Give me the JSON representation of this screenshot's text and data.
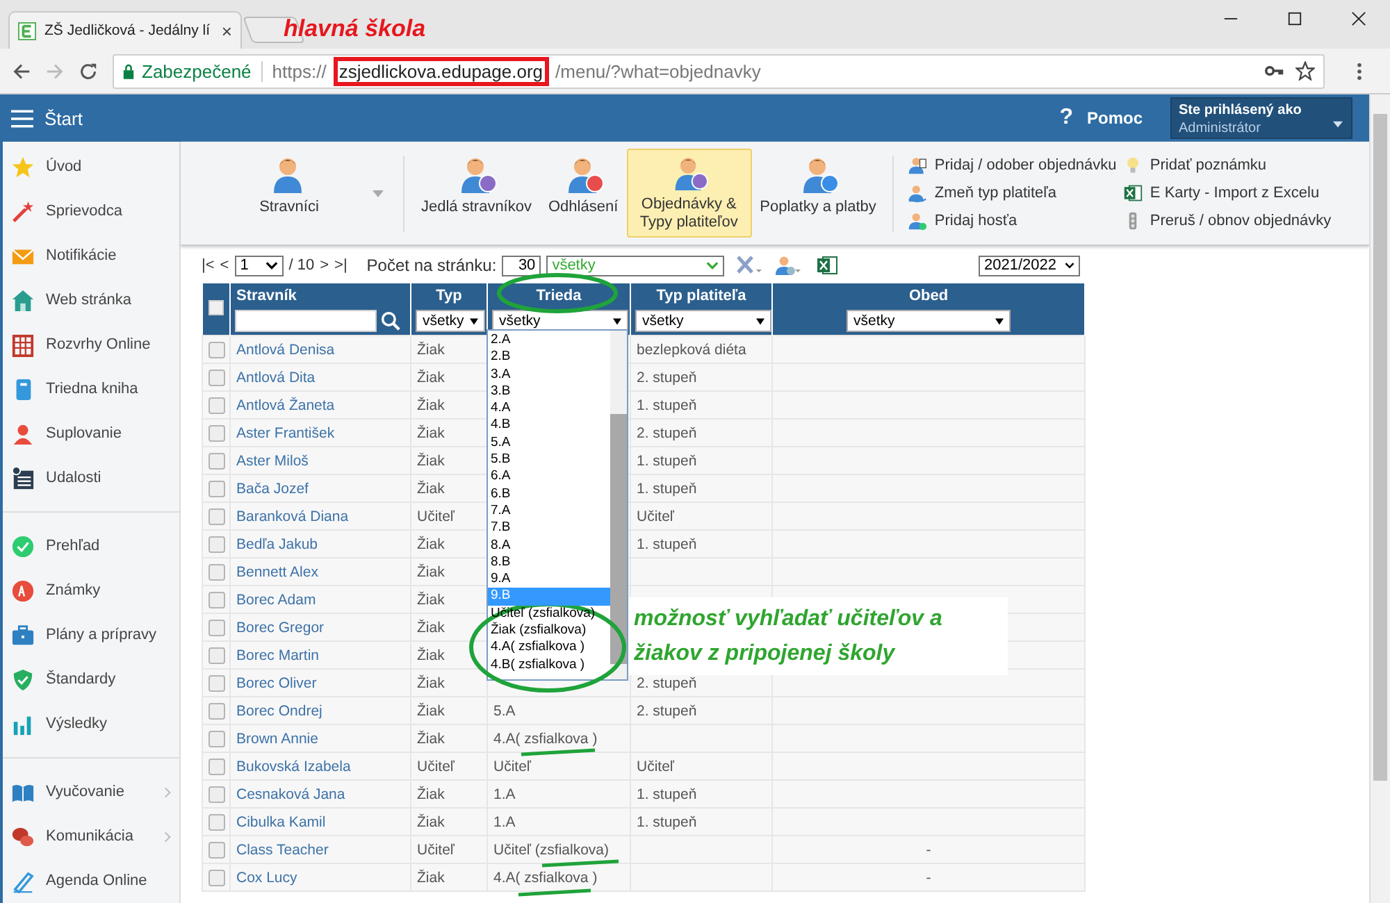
{
  "browser": {
    "tab_title": "ZŠ Jedličková - Jedálny lí",
    "tab_close": "×",
    "security_label": "Zabezpečené",
    "url_scheme": "https://",
    "url_host": "zsjedlickova.edupage.org",
    "url_path": "/menu/?what=objednavky"
  },
  "annotations": {
    "school_label": "hlavná škola",
    "note_lines": [
      "možnosť vyhľadať učiteľov a",
      "žiakov z pripojenej školy"
    ]
  },
  "header": {
    "title": "Štart",
    "help_icon": "?",
    "help": "Pomoc",
    "user_caption": "Ste prihlásený ako",
    "user_role": "Administrátor"
  },
  "toolbar": {
    "main": "Stravníci",
    "items": [
      {
        "label": "Jedlá stravníkov",
        "selected": false
      },
      {
        "label": "Odhlásení",
        "selected": false
      },
      {
        "label": "Objednávky & Typy platiteľov",
        "selected": true
      },
      {
        "label": "Poplatky a platby",
        "selected": false
      }
    ],
    "actions": [
      "Pridaj / odober objednávku",
      "Zmeň typ platiteľa",
      "Pridaj hosťa",
      "Pridať poznámku",
      "E Karty - Import z Excelu",
      "Preruš / obnov objednávky"
    ]
  },
  "sidebar": {
    "groups": [
      {
        "items": [
          {
            "label": "Úvod",
            "has_submenu": false
          },
          {
            "label": "Sprievodca",
            "has_submenu": false
          },
          {
            "label": "Notifikácie",
            "has_submenu": false
          },
          {
            "label": "Web stránka",
            "has_submenu": false
          },
          {
            "label": "Rozvrhy Online",
            "has_submenu": false
          },
          {
            "label": "Triedna kniha",
            "has_submenu": false
          },
          {
            "label": "Suplovanie",
            "has_submenu": false
          },
          {
            "label": "Udalosti",
            "has_submenu": false
          }
        ]
      },
      {
        "items": [
          {
            "label": "Prehľad",
            "has_submenu": false
          },
          {
            "label": "Známky",
            "has_submenu": false
          },
          {
            "label": "Plány a prípravy",
            "has_submenu": false
          },
          {
            "label": "Štandardy",
            "has_submenu": false
          },
          {
            "label": "Výsledky",
            "has_submenu": false
          }
        ]
      },
      {
        "items": [
          {
            "label": "Vyučovanie",
            "has_submenu": true
          },
          {
            "label": "Komunikácia",
            "has_submenu": true
          },
          {
            "label": "Agenda Online",
            "has_submenu": false
          }
        ]
      }
    ]
  },
  "pager": {
    "first": "|<",
    "prev": "<",
    "page": "1",
    "total": "/ 10",
    "next": ">",
    "last": ">|",
    "per_page_label": "Počet na stránku:",
    "per_page": "30",
    "filter": "všetky",
    "year": "2021/2022"
  },
  "table": {
    "all_checked": false,
    "columns": [
      "Stravník",
      "Typ",
      "Trieda",
      "Typ platiteľa",
      "Obed"
    ],
    "filters": [
      "všetky",
      "všetky",
      "všetky",
      "všetky"
    ],
    "rows": [
      {
        "name": "Antlová Denisa",
        "type": "Žiak",
        "payer": "bezlepková diéta",
        "checked": false
      },
      {
        "name": "Antlová Dita",
        "type": "Žiak",
        "payer": "2. stupeň",
        "checked": false
      },
      {
        "name": "Antlová Žaneta",
        "type": "Žiak",
        "payer": "1. stupeň",
        "checked": false
      },
      {
        "name": "Aster František",
        "type": "Žiak",
        "payer": "2. stupeň",
        "checked": false
      },
      {
        "name": "Aster Miloš",
        "type": "Žiak",
        "payer": "1. stupeň",
        "checked": false
      },
      {
        "name": "Bača Jozef",
        "type": "Žiak",
        "payer": "1. stupeň",
        "checked": false
      },
      {
        "name": "Baranková Diana",
        "type": "Učiteľ",
        "payer": "Učiteľ",
        "checked": false
      },
      {
        "name": "Bedľa Jakub",
        "type": "Žiak",
        "payer": "1. stupeň",
        "checked": false
      },
      {
        "name": "Bennett Alex",
        "type": "Žiak",
        "checked": false
      },
      {
        "name": "Borec Adam",
        "type": "Žiak",
        "checked": false
      },
      {
        "name": "Borec Gregor",
        "type": "Žiak",
        "checked": false
      },
      {
        "name": "Borec Martin",
        "type": "Žiak",
        "checked": false
      },
      {
        "name": "Borec Oliver",
        "type": "Žiak",
        "payer": "2. stupeň",
        "checked": false
      },
      {
        "name": "Borec Ondrej",
        "type": "Žiak",
        "class": "5.A",
        "payer": "2. stupeň",
        "checked": false
      },
      {
        "name": "Brown Annie",
        "type": "Žiak",
        "class": "4.A( zsfialkova )",
        "checked": false
      },
      {
        "name": "Bukovská Izabela",
        "type": "Učiteľ",
        "class": "Učiteľ",
        "payer": "Učiteľ",
        "checked": false
      },
      {
        "name": "Cesnaková Jana",
        "type": "Žiak",
        "class": "1.A",
        "payer": "1. stupeň",
        "checked": false
      },
      {
        "name": "Cibulka Kamil",
        "type": "Žiak",
        "class": "1.A",
        "payer": "1. stupeň",
        "checked": false
      },
      {
        "name": "Class Teacher",
        "type": "Učiteľ",
        "class": "Učiteľ (zsfialkova)",
        "lunch": "-",
        "checked": false
      },
      {
        "name": "Cox Lucy",
        "type": "Žiak",
        "class": "4.A( zsfialkova )",
        "lunch": "-",
        "checked": false
      }
    ]
  },
  "class_dropdown": {
    "options": [
      {
        "label": "2.A",
        "selected": false
      },
      {
        "label": "2.B",
        "selected": false
      },
      {
        "label": "3.A",
        "selected": false
      },
      {
        "label": "3.B",
        "selected": false
      },
      {
        "label": "4.A",
        "selected": false
      },
      {
        "label": "4.B",
        "selected": false
      },
      {
        "label": "5.A",
        "selected": false
      },
      {
        "label": "5.B",
        "selected": false
      },
      {
        "label": "6.A",
        "selected": false
      },
      {
        "label": "6.B",
        "selected": false
      },
      {
        "label": "7.A",
        "selected": false
      },
      {
        "label": "7.B",
        "selected": false
      },
      {
        "label": "8.A",
        "selected": false
      },
      {
        "label": "8.B",
        "selected": false
      },
      {
        "label": "9.A",
        "selected": false
      },
      {
        "label": "9.B",
        "selected": true
      },
      {
        "label": "Učiteľ (zsfialkova)",
        "selected": false
      },
      {
        "label": "Žiak (zsfialkova)",
        "selected": false
      },
      {
        "label": "4.A( zsfialkova )",
        "selected": false
      },
      {
        "label": "4.B( zsfialkova )",
        "selected": false
      }
    ]
  }
}
